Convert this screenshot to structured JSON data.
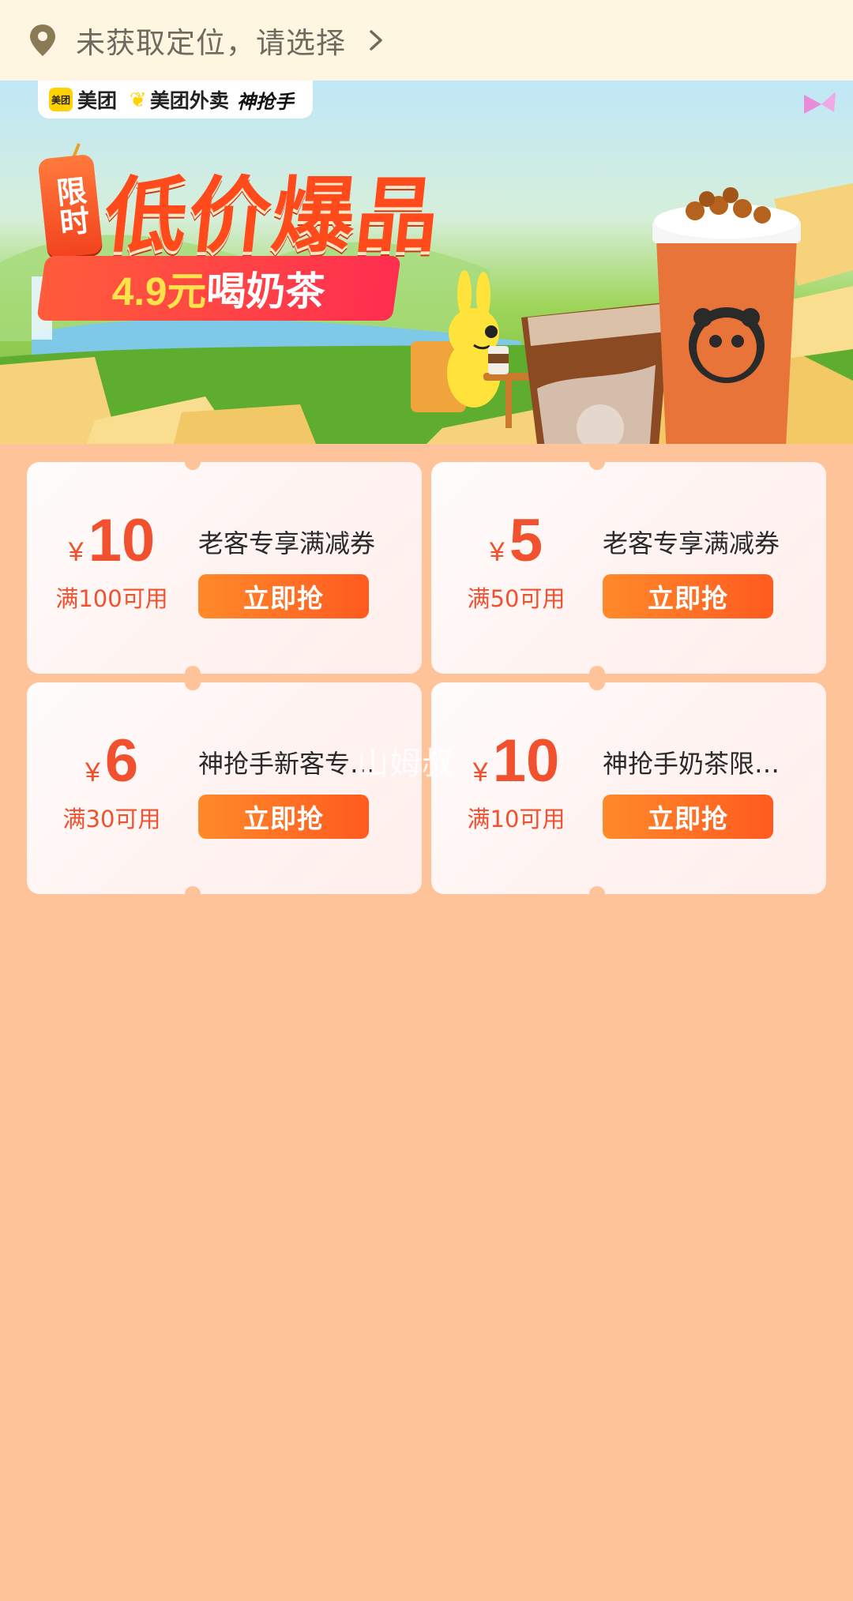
{
  "location_bar": {
    "icon": "location-pin-icon",
    "text": "未获取定位，请选择",
    "chevron": "chevron-right-icon"
  },
  "banner": {
    "brands": [
      "美团",
      "美团外卖",
      "神抢手"
    ],
    "tag": "限时",
    "headline": "低价爆品",
    "subline_price": "4.9元",
    "subline_text": "喝奶茶"
  },
  "coupons": [
    {
      "currency": "¥",
      "amount": "10",
      "condition": "满100可用",
      "title": "老客专享满减券",
      "button": "立即抢"
    },
    {
      "currency": "¥",
      "amount": "5",
      "condition": "满50可用",
      "title": "老客专享满减券",
      "button": "立即抢"
    },
    {
      "currency": "¥",
      "amount": "6",
      "condition": "满30可用",
      "title": "神抢手新客专…",
      "button": "立即抢"
    },
    {
      "currency": "¥",
      "amount": "10",
      "condition": "满10可用",
      "title": "神抢手奶茶限…",
      "button": "立即抢"
    }
  ],
  "watermark": "山姆叔",
  "colors": {
    "page_bg": "#FFC39A",
    "location_bar_bg": "#FFF6E1",
    "accent_red": "#F1512E",
    "button_orange": "#FF6A22"
  }
}
